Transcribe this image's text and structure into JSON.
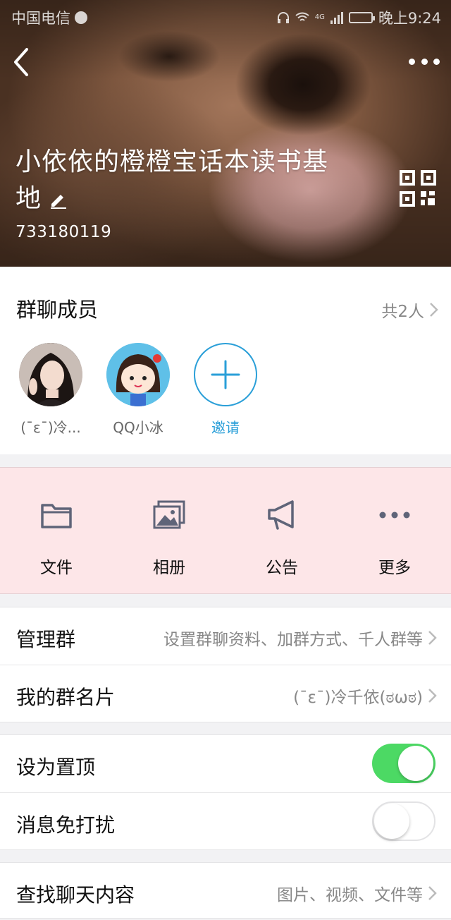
{
  "status_bar": {
    "carrier": "中国电信",
    "network": "4G",
    "time": "晚上9:24"
  },
  "header": {
    "group_name": "小依依的橙橙宝话本读书基地",
    "group_id": "733180119",
    "icons": [
      "back-arrow-icon",
      "more-dots-icon",
      "edit-pencil-icon",
      "qr-code-icon"
    ]
  },
  "members": {
    "title": "群聊成员",
    "count_label": "共2人",
    "list": [
      {
        "name": "(ˉεˉ)冷...",
        "avatar": "girl-photo"
      },
      {
        "name": "QQ小冰",
        "avatar": "cartoon-girl"
      }
    ],
    "invite_label": "邀请"
  },
  "actions": [
    {
      "label": "文件",
      "icon": "folder-icon"
    },
    {
      "label": "相册",
      "icon": "album-icon"
    },
    {
      "label": "公告",
      "icon": "megaphone-icon"
    },
    {
      "label": "更多",
      "icon": "more-dots-icon"
    }
  ],
  "settings": {
    "manage": {
      "label": "管理群",
      "value": "设置群聊资料、加群方式、千人群等"
    },
    "card": {
      "label": "我的群名片",
      "value": "(ˉεˉ)冷千依(ಠωಠ)"
    },
    "pin": {
      "label": "设为置顶",
      "enabled": true
    },
    "mute": {
      "label": "消息免打扰",
      "enabled": false
    },
    "search": {
      "label": "查找聊天内容",
      "value": "图片、视频、文件等"
    }
  },
  "colors": {
    "accent": "#2a9fd8",
    "toggle_on": "#4cd964",
    "action_bg": "#fde6e8"
  }
}
